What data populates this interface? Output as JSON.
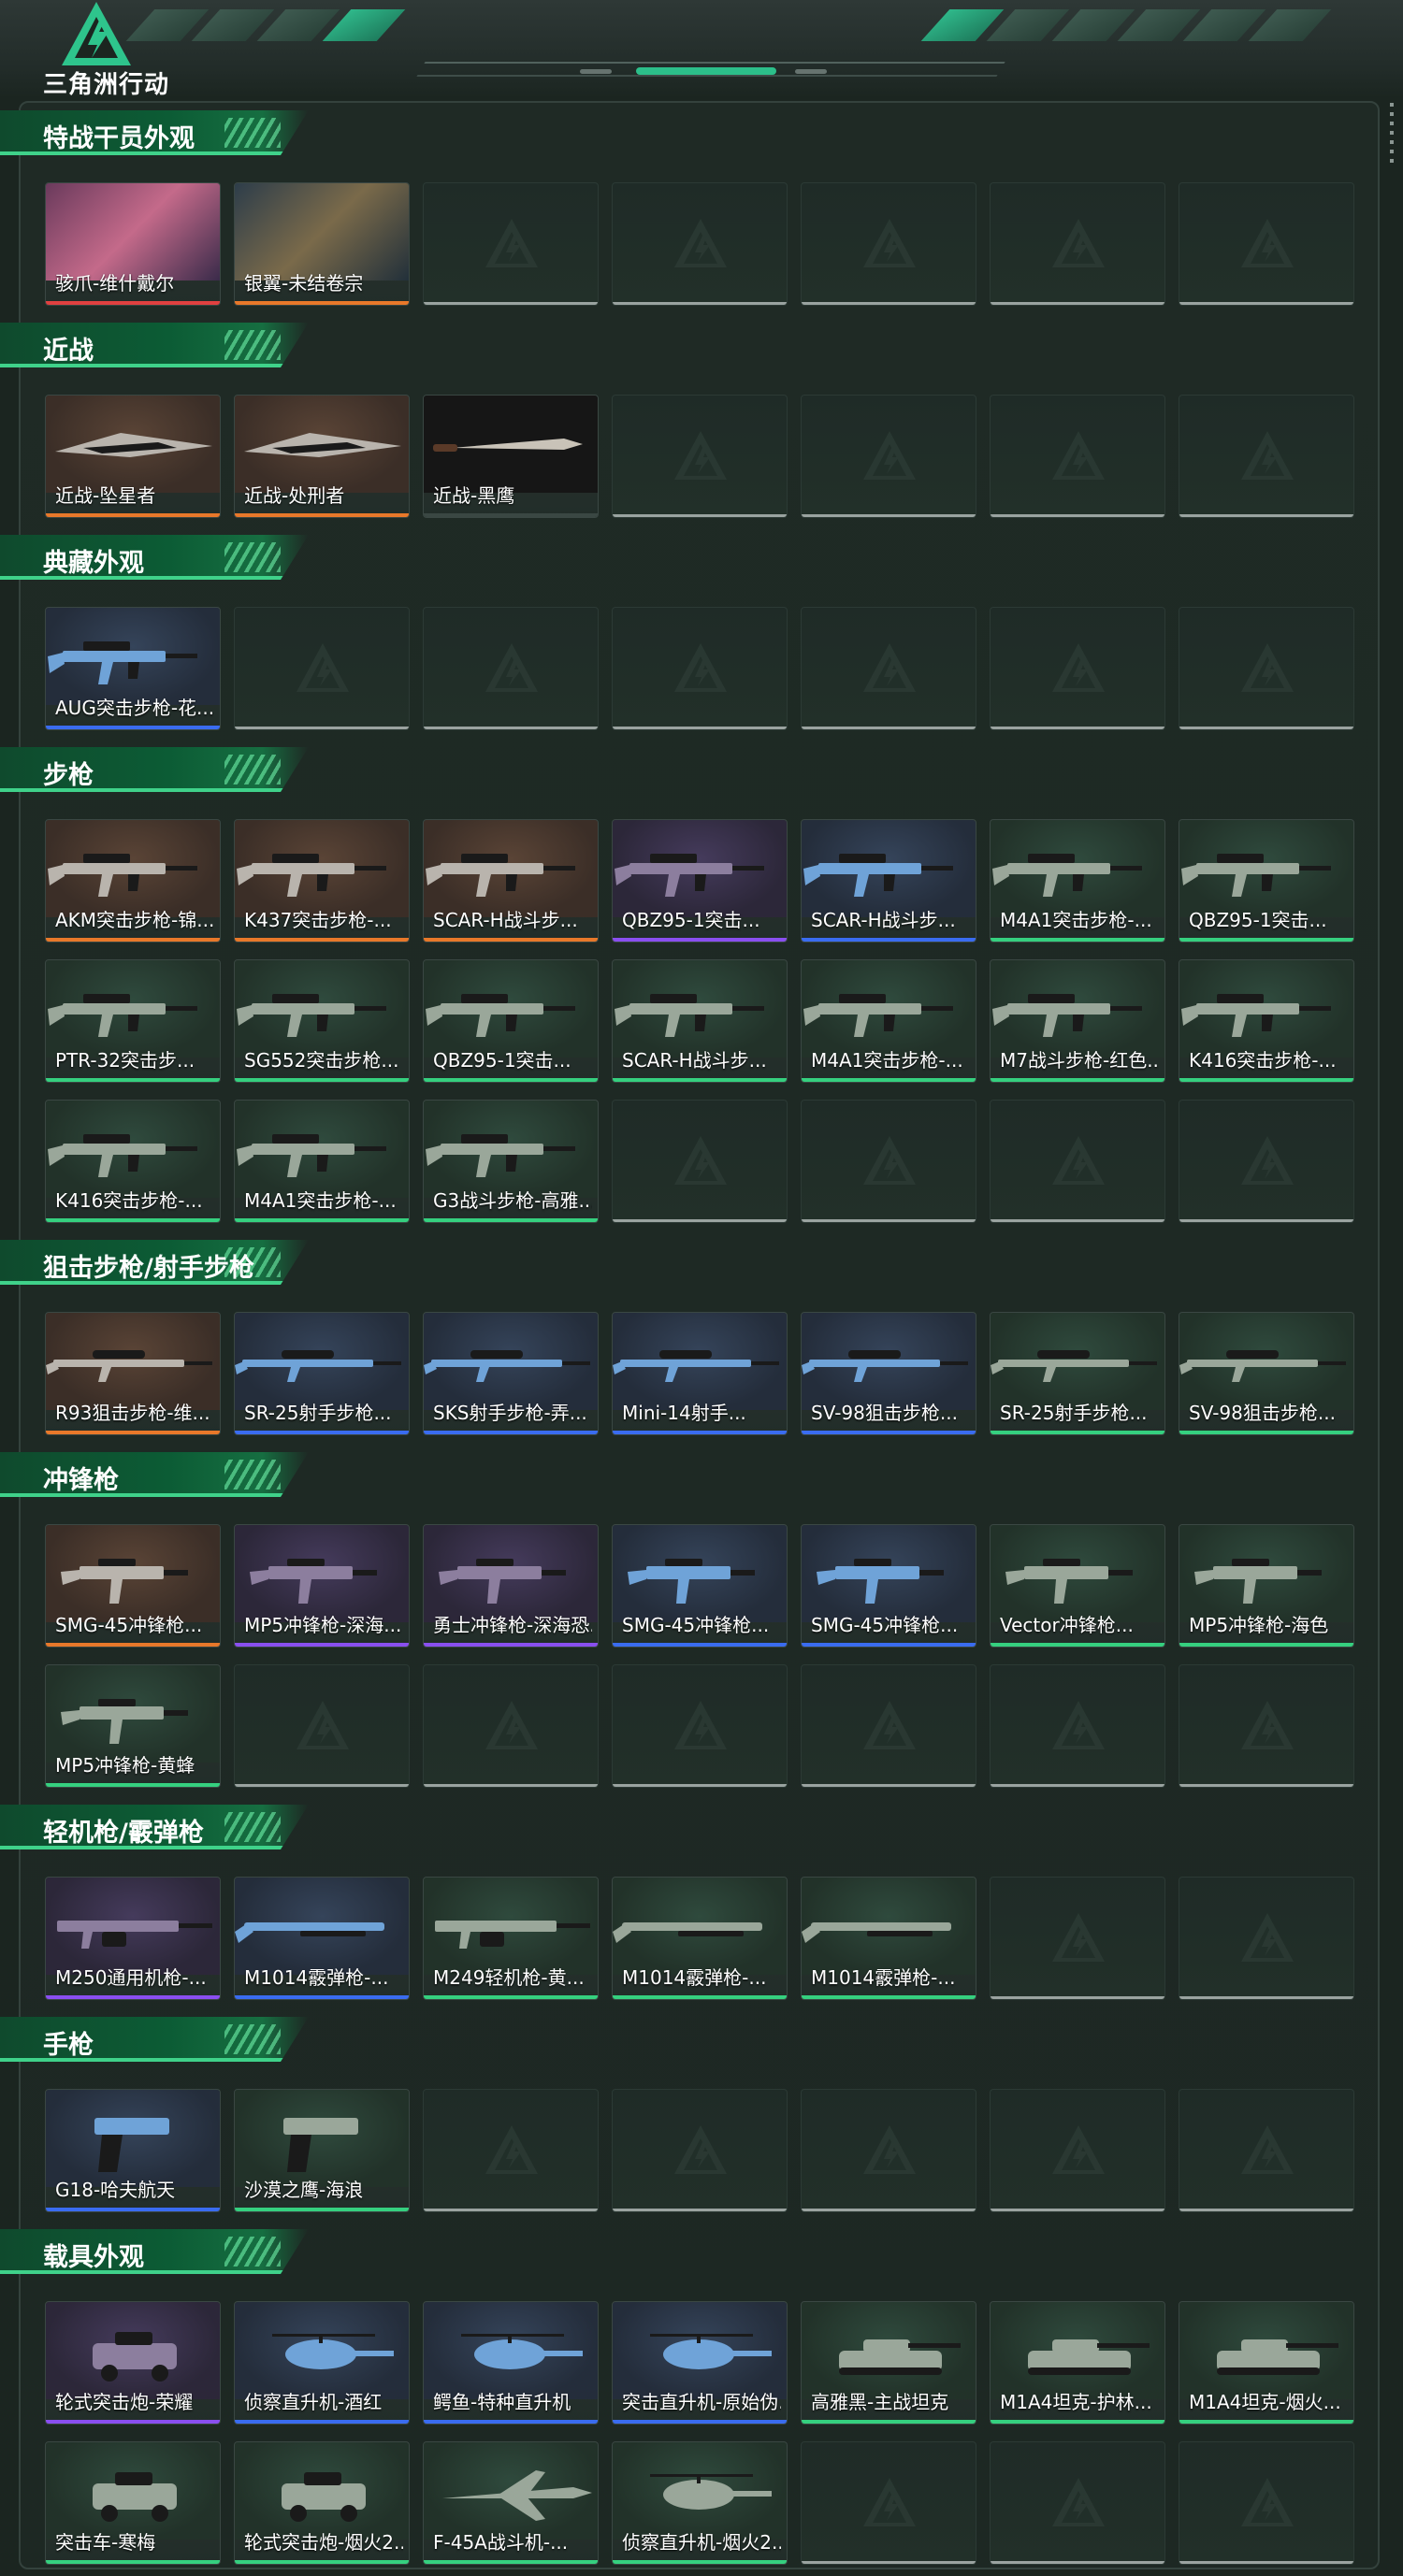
{
  "header": {
    "logo_text": "三角洲行动",
    "logo_icon": "delta-logo-icon"
  },
  "colors": {
    "accent": "#3fd28a",
    "rarity_orange": "#e8782a",
    "rarity_purple": "#8a4ff0",
    "rarity_blue": "#3a6cf0",
    "rarity_green": "#35d07f",
    "rarity_red": "#e04040",
    "empty": "#9aa3a0"
  },
  "sections": [
    {
      "title": "特战干员外观",
      "items": [
        {
          "name": "骇爪-维什戴尔",
          "rarity": "red",
          "icon": "operator-portrait"
        },
        {
          "name": "银翼-未结卷宗",
          "rarity": "orange",
          "icon": "operator-portrait"
        }
      ]
    },
    {
      "title": "近战",
      "items": [
        {
          "name": "近战-坠星者",
          "rarity": "orange",
          "icon": "melee-blade"
        },
        {
          "name": "近战-处刑者",
          "rarity": "orange",
          "icon": "melee-blade"
        },
        {
          "name": "近战-黑鹰",
          "rarity": "none",
          "icon": "knife"
        }
      ]
    },
    {
      "title": "典藏外观",
      "items": [
        {
          "name": "AUG突击步枪-花...",
          "rarity": "blue",
          "icon": "rifle"
        }
      ]
    },
    {
      "title": "步枪",
      "items": [
        {
          "name": "AKM突击步枪-锦...",
          "rarity": "orange",
          "icon": "rifle"
        },
        {
          "name": "K437突击步枪-...",
          "rarity": "orange",
          "icon": "rifle"
        },
        {
          "name": "SCAR-H战斗步...",
          "rarity": "orange",
          "icon": "rifle"
        },
        {
          "name": "QBZ95-1突击...",
          "rarity": "purple",
          "icon": "rifle"
        },
        {
          "name": "SCAR-H战斗步...",
          "rarity": "blue",
          "icon": "rifle"
        },
        {
          "name": "M4A1突击步枪-...",
          "rarity": "green",
          "icon": "rifle"
        },
        {
          "name": "QBZ95-1突击...",
          "rarity": "green",
          "icon": "rifle"
        },
        {
          "name": "PTR-32突击步...",
          "rarity": "green",
          "icon": "rifle"
        },
        {
          "name": "SG552突击步枪...",
          "rarity": "green",
          "icon": "rifle"
        },
        {
          "name": "QBZ95-1突击...",
          "rarity": "green",
          "icon": "rifle"
        },
        {
          "name": "SCAR-H战斗步...",
          "rarity": "green",
          "icon": "rifle"
        },
        {
          "name": "M4A1突击步枪-...",
          "rarity": "green",
          "icon": "rifle"
        },
        {
          "name": "M7战斗步枪-红色...",
          "rarity": "green",
          "icon": "rifle"
        },
        {
          "name": "K416突击步枪-...",
          "rarity": "green",
          "icon": "rifle"
        },
        {
          "name": "K416突击步枪-...",
          "rarity": "green",
          "icon": "rifle"
        },
        {
          "name": "M4A1突击步枪-...",
          "rarity": "green",
          "icon": "rifle"
        },
        {
          "name": "G3战斗步枪-高雅...",
          "rarity": "green",
          "icon": "rifle"
        }
      ]
    },
    {
      "title": "狙击步枪/射手步枪",
      "items": [
        {
          "name": "R93狙击步枪-维...",
          "rarity": "orange",
          "icon": "sniper"
        },
        {
          "name": "SR-25射手步枪...",
          "rarity": "blue",
          "icon": "sniper"
        },
        {
          "name": "SKS射手步枪-弄...",
          "rarity": "blue",
          "icon": "sniper"
        },
        {
          "name": "Mini-14射手...",
          "rarity": "blue",
          "icon": "sniper"
        },
        {
          "name": "SV-98狙击步枪...",
          "rarity": "blue",
          "icon": "sniper"
        },
        {
          "name": "SR-25射手步枪...",
          "rarity": "green",
          "icon": "sniper"
        },
        {
          "name": "SV-98狙击步枪...",
          "rarity": "green",
          "icon": "sniper"
        }
      ]
    },
    {
      "title": "冲锋枪",
      "items": [
        {
          "name": "SMG-45冲锋枪...",
          "rarity": "orange",
          "icon": "smg"
        },
        {
          "name": "MP5冲锋枪-深海...",
          "rarity": "purple",
          "icon": "smg"
        },
        {
          "name": "勇士冲锋枪-深海恐...",
          "rarity": "purple",
          "icon": "smg"
        },
        {
          "name": "SMG-45冲锋枪...",
          "rarity": "blue",
          "icon": "smg"
        },
        {
          "name": "SMG-45冲锋枪...",
          "rarity": "blue",
          "icon": "smg"
        },
        {
          "name": "Vector冲锋枪...",
          "rarity": "green",
          "icon": "smg"
        },
        {
          "name": "MP5冲锋枪-海色",
          "rarity": "green",
          "icon": "smg"
        },
        {
          "name": "MP5冲锋枪-黄蜂",
          "rarity": "green",
          "icon": "smg"
        }
      ]
    },
    {
      "title": "轻机枪/霰弹枪",
      "items": [
        {
          "name": "M250通用机枪-...",
          "rarity": "purple",
          "icon": "lmg"
        },
        {
          "name": "M1014霰弹枪-...",
          "rarity": "blue",
          "icon": "shotgun"
        },
        {
          "name": "M249轻机枪-黄...",
          "rarity": "green",
          "icon": "lmg"
        },
        {
          "name": "M1014霰弹枪-...",
          "rarity": "green",
          "icon": "shotgun"
        },
        {
          "name": "M1014霰弹枪-...",
          "rarity": "green",
          "icon": "shotgun"
        }
      ]
    },
    {
      "title": "手枪",
      "items": [
        {
          "name": "G18-哈夫航天",
          "rarity": "blue",
          "icon": "pistol"
        },
        {
          "name": "沙漠之鹰-海浪",
          "rarity": "green",
          "icon": "pistol"
        }
      ]
    },
    {
      "title": "载具外观",
      "items": [
        {
          "name": "轮式突击炮-荣耀",
          "rarity": "purple",
          "icon": "vehicle"
        },
        {
          "name": "侦察直升机-酒红",
          "rarity": "blue",
          "icon": "helicopter"
        },
        {
          "name": "鳄鱼-特种直升机",
          "rarity": "blue",
          "icon": "helicopter"
        },
        {
          "name": "突击直升机-原始伪...",
          "rarity": "blue",
          "icon": "helicopter"
        },
        {
          "name": "高雅黑-主战坦克",
          "rarity": "green",
          "icon": "tank"
        },
        {
          "name": "M1A4坦克-护林...",
          "rarity": "green",
          "icon": "tank"
        },
        {
          "name": "M1A4坦克-烟火...",
          "rarity": "green",
          "icon": "tank"
        },
        {
          "name": "突击车-寒梅",
          "rarity": "green",
          "icon": "vehicle"
        },
        {
          "name": "轮式突击炮-烟火2...",
          "rarity": "green",
          "icon": "vehicle"
        },
        {
          "name": "F-45A战斗机-...",
          "rarity": "green",
          "icon": "jet"
        },
        {
          "name": "侦察直升机-烟火2...",
          "rarity": "green",
          "icon": "helicopter"
        }
      ]
    }
  ]
}
